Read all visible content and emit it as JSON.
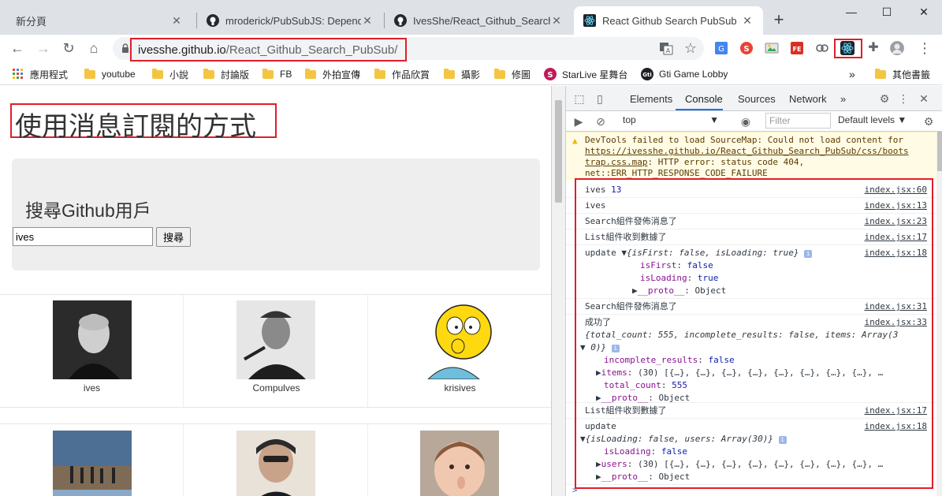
{
  "browser": {
    "tabs": [
      {
        "label": "新分頁",
        "active": false
      },
      {
        "label": "mroderick/PubSubJS: Depende",
        "active": false
      },
      {
        "label": "IvesShe/React_Github_Search_l",
        "active": false
      },
      {
        "label": "React Github Search PubSub",
        "active": true
      }
    ],
    "new_tab": "+",
    "window": {
      "minimize": "—",
      "maximize": "☐",
      "close": "✕"
    },
    "url_host": "ivesshe.github.io",
    "url_path": "/React_Github_Search_PubSub/",
    "bookmarks": [
      "應用程式",
      "youtube",
      "小說",
      "討論版",
      "FB",
      "外拍宣傳",
      "作品欣賞",
      "攝影",
      "修圖",
      "StarLive 星舞台",
      "Gti Game Lobby",
      "»",
      "其他書籤"
    ]
  },
  "page": {
    "title": "使用消息訂閱的方式",
    "search_heading": "搜尋Github用戶",
    "search_value": "ives",
    "search_button": "搜尋",
    "users": [
      {
        "login": "ives"
      },
      {
        "login": "Compulves"
      },
      {
        "login": "krisives"
      },
      {
        "login": ""
      },
      {
        "login": ""
      },
      {
        "login": ""
      }
    ]
  },
  "devtools": {
    "tabs": [
      "Elements",
      "Console",
      "Sources",
      "Network",
      "»"
    ],
    "active_tab": "Console",
    "context": "top",
    "filter_placeholder": "Filter",
    "levels": "Default levels ▼",
    "warning": {
      "line1": "DevTools failed to load SourceMap: Could not load content for",
      "link1": "https://ivesshe.github.io/React_Github_Search_PubSub/css/boots",
      "link2": "trap.css.map",
      "line2_rest": ": HTTP error: status code 404,",
      "line3": "net::ERR_HTTP_RESPONSE_CODE_FAILURE"
    },
    "messages": [
      {
        "text": "ives",
        "num": "13",
        "src": "index.jsx:60"
      },
      {
        "text": "ives",
        "src": "index.jsx:13"
      },
      {
        "text": "Search組件發佈消息了",
        "src": "index.jsx:23"
      },
      {
        "text": "List組件收到數據了",
        "src": "index.jsx:17"
      },
      {
        "text": "update",
        "obj": "{isFirst: false, isLoading: true}",
        "p1k": "isFirst",
        "p1v": "false",
        "p2k": "isLoading",
        "p2v": "true",
        "proto": "__proto__",
        "protov": "Object",
        "src": "index.jsx:18"
      },
      {
        "text": "Search組件發佈消息了",
        "src": "index.jsx:31"
      },
      {
        "text": "成功了",
        "obj1": "{total_count: 555, incomplete_results: false, items: Array(3",
        "obj2": "0)}",
        "p1k": "incomplete_results",
        "p1v": "false",
        "p2k": "items",
        "p2v": "(30) [{…}, {…}, {…}, {…}, {…}, {…}, {…}, {…}, …",
        "p3k": "total_count",
        "p3v": "555",
        "proto": "__proto__",
        "protov": "Object",
        "src": "index.jsx:33"
      },
      {
        "text": "List組件收到數據了",
        "src": "index.jsx:17"
      },
      {
        "text": "update",
        "obj": "{isLoading: false, users: Array(30)}",
        "p1k": "isLoading",
        "p1v": "false",
        "p2k": "users",
        "p2v": "(30) [{…}, {…}, {…}, {…}, {…}, {…}, {…}, {…}, …",
        "proto": "__proto__",
        "protov": "Object",
        "src": "index.jsx:18"
      }
    ],
    "prompt": ">"
  }
}
